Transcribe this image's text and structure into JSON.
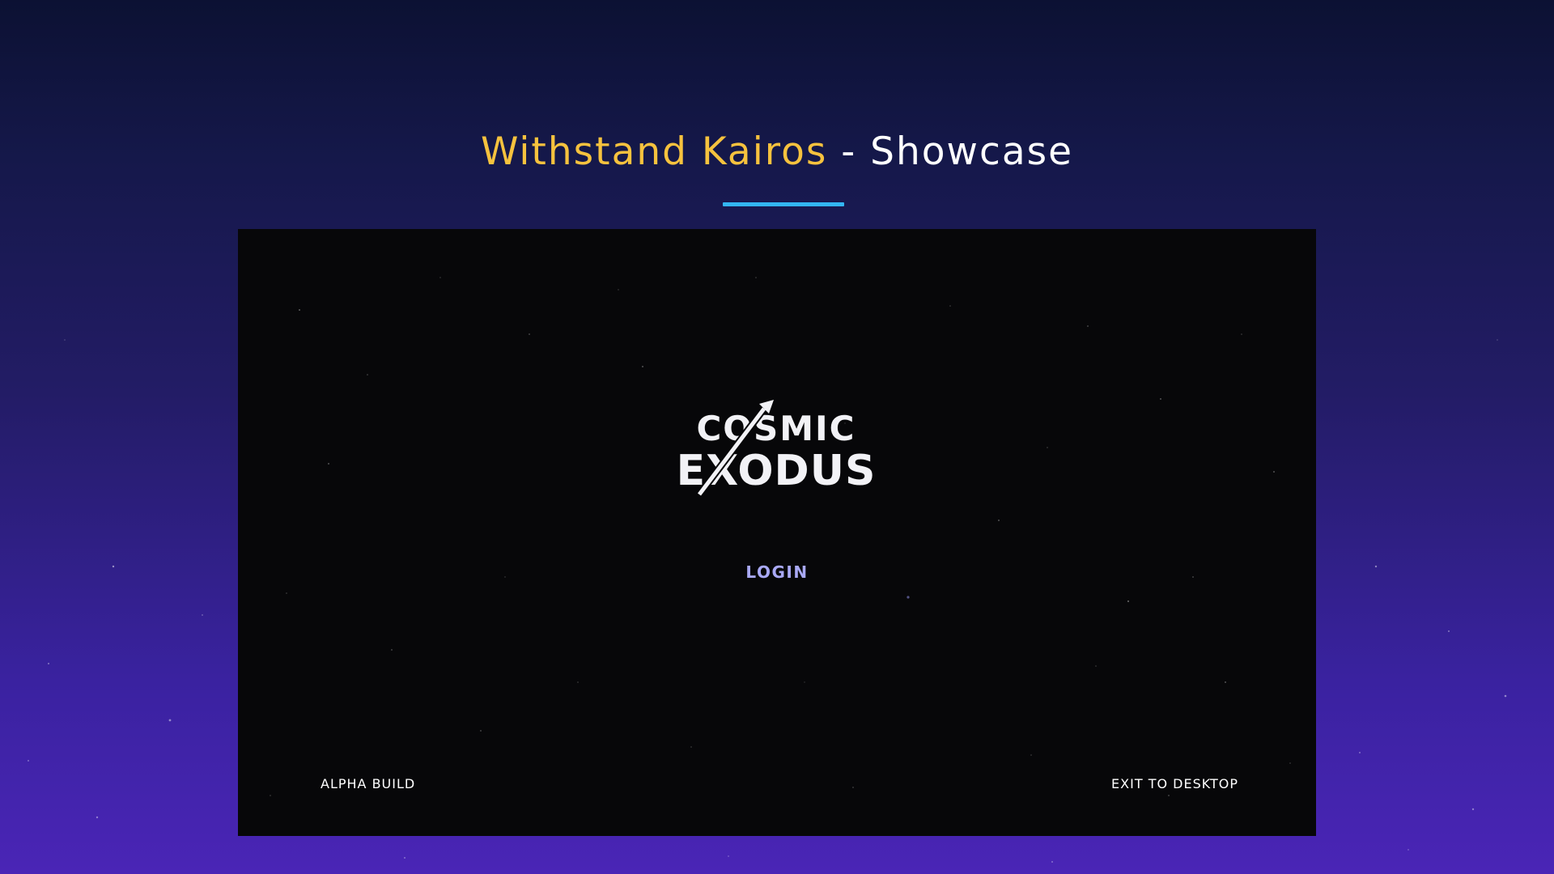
{
  "header": {
    "title_accent": "Withstand Kairos",
    "title_separator": " - ",
    "title_rest": "Showcase"
  },
  "game": {
    "logo": {
      "line1": "COSMIC",
      "line2": "EXODUS"
    },
    "login_label": "LOGIN",
    "build_label": "ALPHA BUILD",
    "exit_label": "EXIT TO DESKTOP"
  },
  "colors": {
    "title_accent": "#f6c23e",
    "underline": "#33b6f2",
    "login": "#a9a9f5",
    "frame_bg": "#070709"
  },
  "icons": {
    "logo_emblem": "rocket-arrow-icon"
  }
}
